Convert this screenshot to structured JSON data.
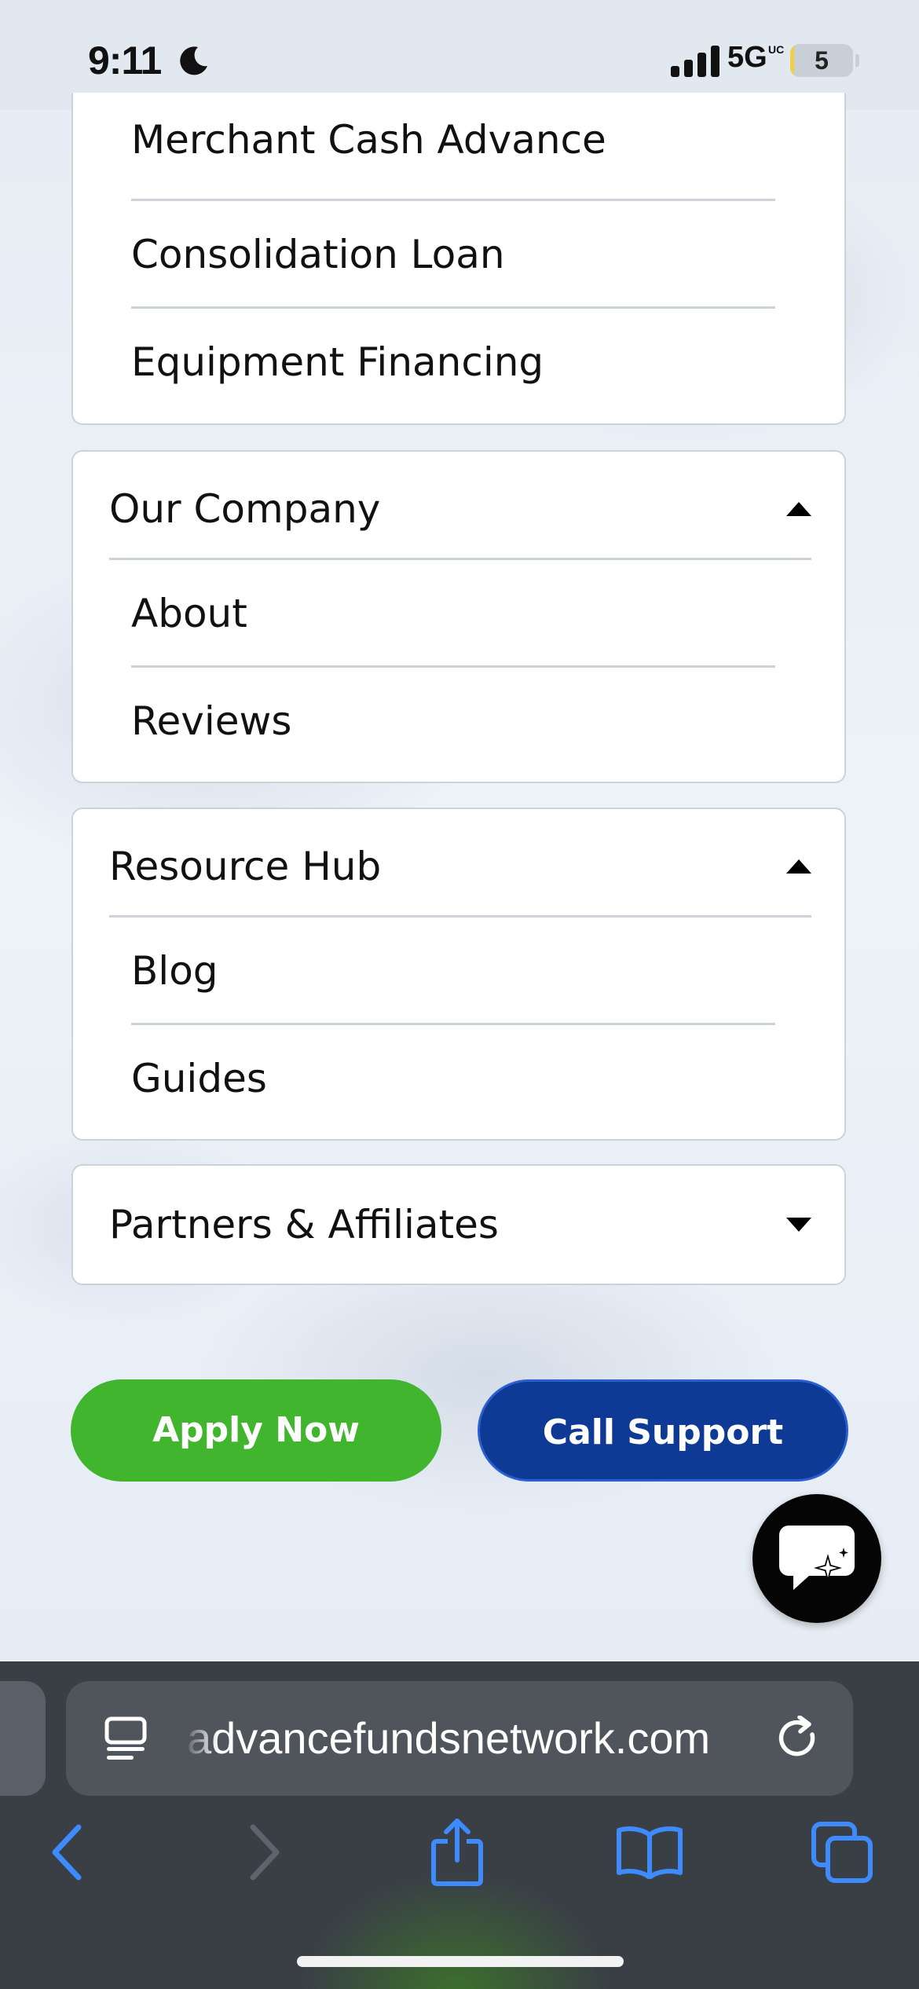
{
  "status_bar": {
    "time": "9:11",
    "network": "5G",
    "network_sub": "UC",
    "battery_level": "5",
    "battery_percent": 5,
    "icons": [
      "moon-icon",
      "signal-icon",
      "battery-icon"
    ]
  },
  "menu": {
    "loan_items": [
      {
        "label": "Merchant Cash Advance"
      },
      {
        "label": "Consolidation Loan"
      },
      {
        "label": "Equipment Financing"
      }
    ],
    "our_company": {
      "label": "Our Company",
      "expanded": true,
      "items": [
        {
          "label": "About"
        },
        {
          "label": "Reviews"
        }
      ]
    },
    "resource_hub": {
      "label": "Resource Hub",
      "expanded": true,
      "items": [
        {
          "label": "Blog"
        },
        {
          "label": "Guides"
        }
      ]
    },
    "partners": {
      "label": "Partners & Affiliates",
      "expanded": false
    }
  },
  "actions": {
    "apply_label": "Apply Now",
    "call_label": "Call Support"
  },
  "browser": {
    "url": "advancefundsnetwork.com",
    "toolbar_icons": [
      "back-icon",
      "forward-icon",
      "share-icon",
      "bookmarks-icon",
      "tabs-icon"
    ]
  },
  "colors": {
    "apply_green": "#41b52e",
    "call_blue": "#0e3a96",
    "ios_blue": "#3d8bff"
  }
}
